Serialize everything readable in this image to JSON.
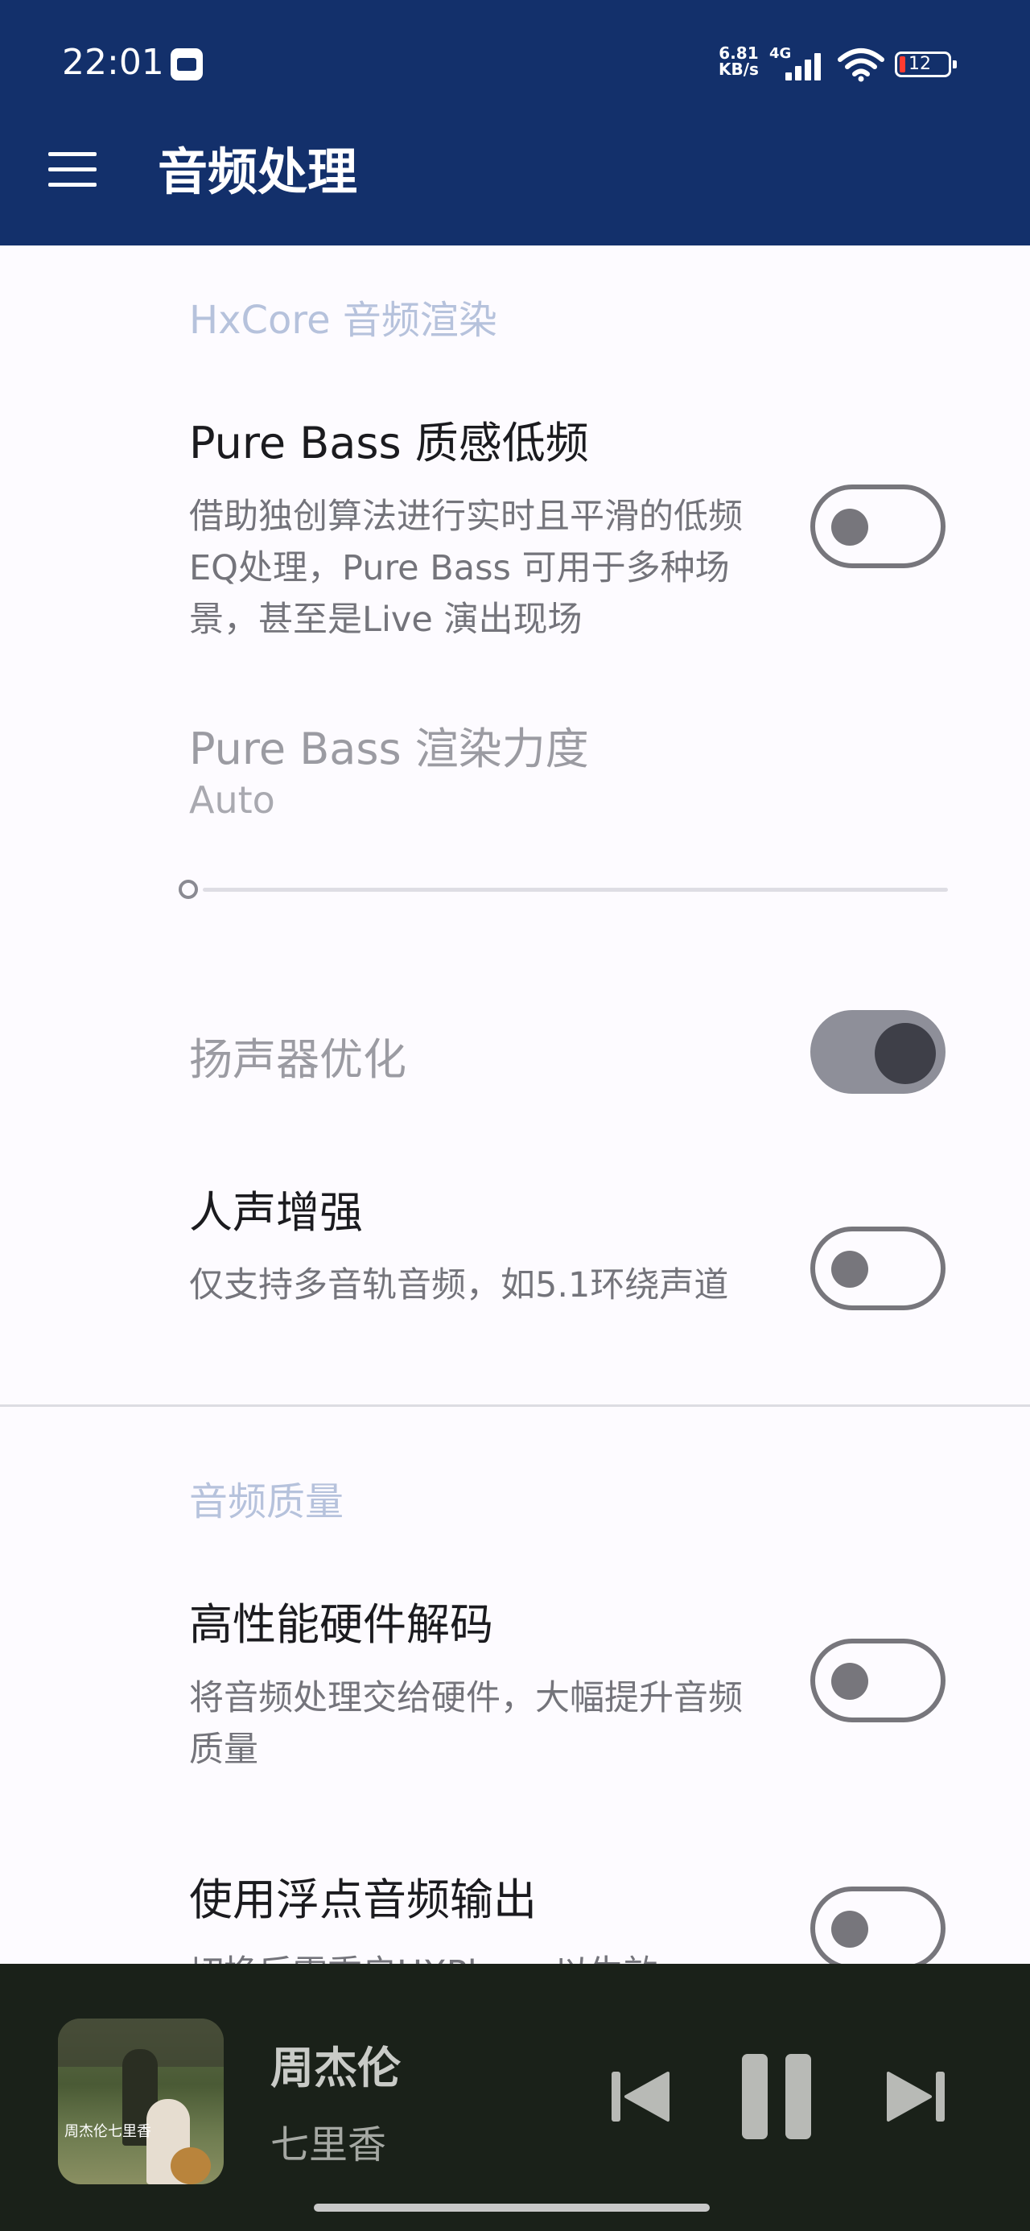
{
  "status_bar": {
    "time": "22:01",
    "speed_value": "6.81",
    "speed_unit": "KB/s",
    "network": "4G",
    "battery": "12"
  },
  "app_bar": {
    "title": "音频处理",
    "menu_icon": "menu-icon"
  },
  "sections": {
    "render": {
      "header": "HxCore 音频渲染",
      "pure_bass": {
        "title": "Pure Bass 质感低频",
        "summary": "借助独创算法进行实时且平滑的低频EQ处理，Pure Bass 可用于多种场景，甚至是Live 演出现场",
        "enabled": false
      },
      "pure_bass_strength": {
        "title": "Pure Bass 渲染力度",
        "value": "Auto",
        "level": 0
      },
      "speaker_opt": {
        "title": "扬声器优化",
        "enabled": true
      },
      "vocal": {
        "title": "人声增强",
        "summary": "仅支持多音轨音频，如5.1环绕声道",
        "enabled": false
      }
    },
    "quality": {
      "header": "音频质量",
      "hw_decode": {
        "title": "高性能硬件解码",
        "summary": "将音频处理交给硬件，大幅提升音频质量",
        "enabled": false
      },
      "float_output": {
        "title": "使用浮点音频输出",
        "summary": "切换后需重启HXPlayer以生效",
        "enabled": false
      }
    }
  },
  "player": {
    "artist": "周杰伦",
    "song": "七里香",
    "album_caption": "周杰伦七里香",
    "controls": [
      "previous-icon",
      "pause-icon",
      "next-icon"
    ]
  },
  "colors": {
    "app_bar": "#13306b",
    "background": "#fdfbff",
    "player": "#1a2119"
  }
}
